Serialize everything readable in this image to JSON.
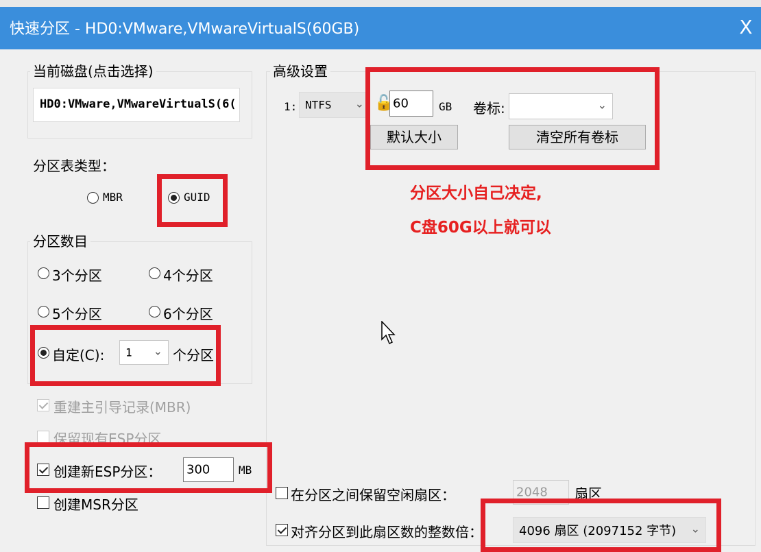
{
  "window": {
    "title": "快速分区 - HD0:VMware,VMwareVirtualS(60GB)",
    "close": "X"
  },
  "disk": {
    "legend": "当前磁盘(点击选择)",
    "selected": "HD0:VMware,VMwareVirtualS(6("
  },
  "partition_table": {
    "label": "分区表类型：",
    "options": [
      {
        "label": "MBR",
        "checked": false
      },
      {
        "label": "GUID",
        "checked": true
      }
    ]
  },
  "partition_count": {
    "legend": "分区数目",
    "options": [
      {
        "label": "3个分区",
        "checked": false
      },
      {
        "label": "4个分区",
        "checked": false
      },
      {
        "label": "5个分区",
        "checked": false
      },
      {
        "label": "6个分区",
        "checked": false
      }
    ],
    "custom": {
      "label": "自定(C):",
      "value": "1",
      "suffix": "个分区",
      "checked": true
    }
  },
  "options": {
    "rebuild_mbr": {
      "label": "重建主引导记录(MBR)",
      "checked": true,
      "disabled": true
    },
    "keep_esp": {
      "label": "保留现有ESP分区",
      "checked": false,
      "disabled": true
    },
    "new_esp": {
      "label": "创建新ESP分区：",
      "checked": true,
      "value": "300",
      "unit": "MB"
    },
    "new_msr": {
      "label": "创建MSR分区",
      "checked": false
    }
  },
  "advanced": {
    "legend": "高级设置",
    "row_index": "1:",
    "fs": "NTFS",
    "size": "60",
    "size_unit": "GB",
    "volume_label": "卷标:",
    "volume_value": "",
    "default_size_button": "默认大小",
    "clear_labels_button": "清空所有卷标"
  },
  "annotation": {
    "line1": "分区大小自己决定,",
    "line2": "C盘60G以上就可以"
  },
  "reserve": {
    "label": "在分区之间保留空闲扇区：",
    "checked": false,
    "value": "2048",
    "unit": "扇区"
  },
  "align": {
    "label": "对齐分区到此扇区数的整数倍：",
    "checked": true,
    "value": "4096 扇区 (2097152 字节)"
  },
  "colors": {
    "titlebar": "#3a8edc",
    "highlight": "#e0202a",
    "annotation": "#e62020"
  }
}
